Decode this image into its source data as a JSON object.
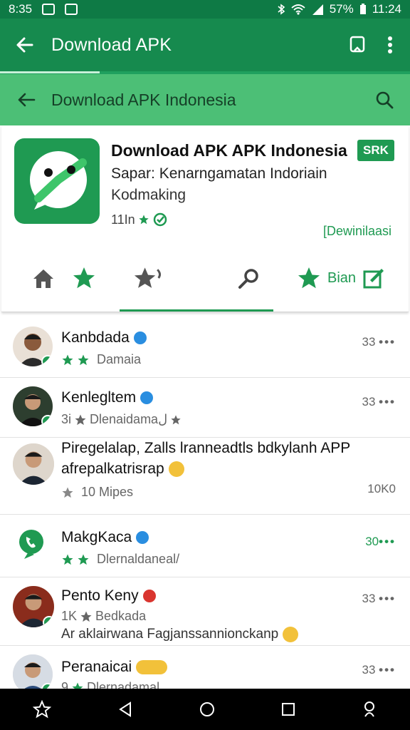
{
  "status_bar": {
    "time_left": "8:35",
    "battery": "57%",
    "time_right": "11:24"
  },
  "app_bar": {
    "title": "Download APK"
  },
  "search_bar": {
    "title": "Download APK Indonesia"
  },
  "app": {
    "title": "Download APK APK Indonesia",
    "badge": "SRK",
    "subtitle": "Sapar: Kenarngamatan Indoriain",
    "developer": "Kodmaking",
    "rating_text": "11In",
    "download_link": "[Dewinilaasi"
  },
  "actions": {
    "save_label": "Bian"
  },
  "reviews": [
    {
      "name": "Kanbdada",
      "meta": "Damaia",
      "count": "33"
    },
    {
      "name": "Kenlegltem",
      "meta_prefix": "3i",
      "meta": "Dlenaidamaل",
      "count": "33"
    },
    {
      "comment_line1": "Piregelalap, Zalls lranneadtls bdkylanh APP",
      "comment_line2": "afrepalkatrisrap",
      "meta": "10 Mipes",
      "count": "10K0"
    },
    {
      "name": "MakgKaca",
      "meta": "Dlernaldaneal/",
      "count": "30"
    },
    {
      "name": "Pento Keny",
      "meta_prefix": "1K",
      "meta": "Bedkada",
      "comment": "Ar  aklairwana Fagjanssannionckanp",
      "count": "33"
    },
    {
      "name": "Peranaicai",
      "meta_prefix": "9",
      "meta": "Dlernadamal",
      "count": "33"
    }
  ],
  "colors": {
    "primary": "#168a4e",
    "accent": "#1f9a52",
    "light_green": "#4cbf76"
  }
}
